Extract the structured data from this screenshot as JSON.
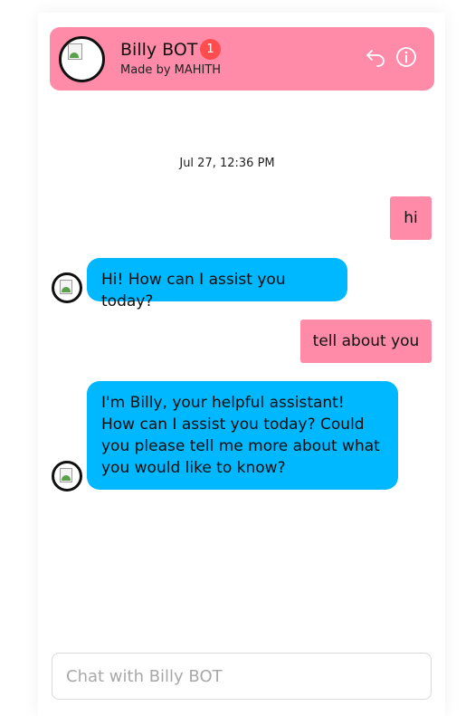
{
  "header": {
    "title": "Billy BOT",
    "badge_count": "1",
    "subtitle": "Made by MAHITH",
    "back_icon": "undo-arrow-icon",
    "info_icon": "info-circle-icon"
  },
  "conversation": {
    "timestamp": "Jul 27, 12:36 PM",
    "messages": [
      {
        "from": "user",
        "text": "hi"
      },
      {
        "from": "bot",
        "text": "Hi! How can I assist you today?"
      },
      {
        "from": "user",
        "text": "tell about  you"
      },
      {
        "from": "bot",
        "text": "I'm Billy, your helpful assistant! How can I assist you today? Could you please tell me more about what you would like to know?"
      }
    ]
  },
  "composer": {
    "placeholder": "Chat with Billy BOT"
  },
  "colors": {
    "header_bg": "#ff8ba8",
    "user_bubble": "#ff8ba8",
    "bot_bubble": "#00b8ff",
    "badge": "#ff4d4f"
  }
}
